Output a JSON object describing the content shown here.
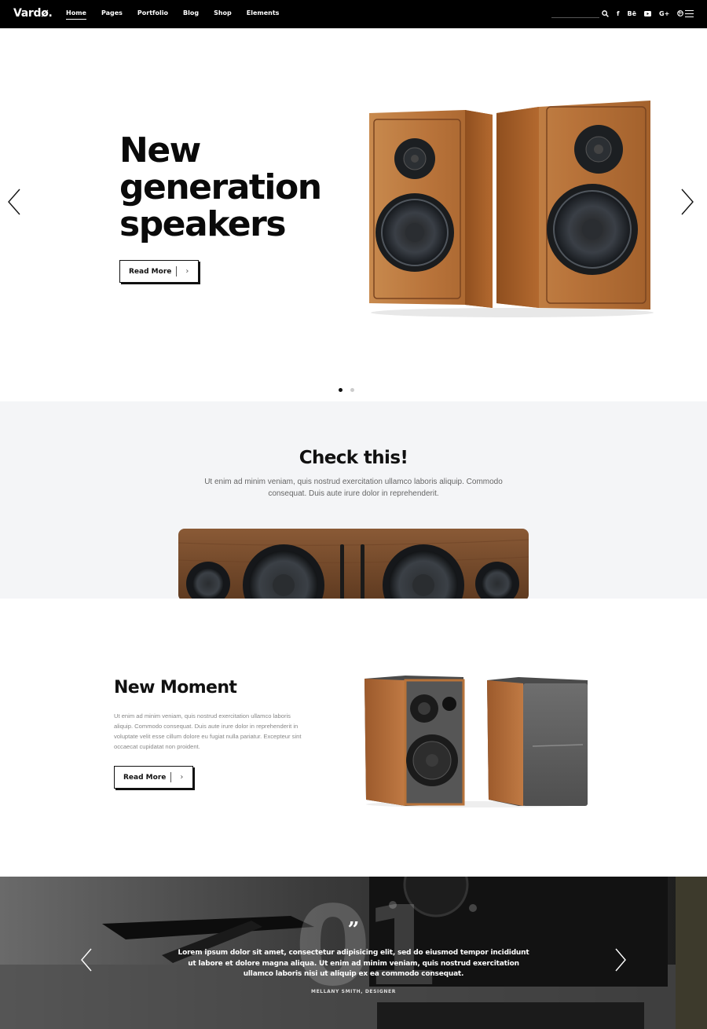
{
  "nav": {
    "logo": "Vardø.",
    "menu": [
      "Home",
      "Pages",
      "Portfolio",
      "Blog",
      "Shop",
      "Elements"
    ],
    "active_item": "Home",
    "social": {
      "search_icon": "search-icon",
      "facebook": "f",
      "behance": "Bē",
      "youtube_icon": "youtube-icon",
      "googleplus": "G+",
      "dribbble_icon": "dribbble-icon",
      "menu_icon": "hamburger-icon"
    }
  },
  "hero": {
    "title_lines": [
      "New",
      "generation",
      "speakers"
    ],
    "button_label": "Read More",
    "slides": 2,
    "active_slide": 1
  },
  "check": {
    "title": "Check this!",
    "text": "Ut enim ad minim veniam, quis nostrud exercitation ullamco laboris aliquip. Commodo consequat. Duis aute irure dolor in reprehenderit."
  },
  "moment": {
    "title": "New Moment",
    "text": "Ut enim ad minim veniam, quis nostrud exercitation ullamco laboris aliquip. Commodo consequat. Duis aute irure dolor in reprehenderit in voluptate velit esse cillum dolore eu fugiat nulla pariatur. Excepteur sint occaecat cupidatat non proident.",
    "button_label": "Read More"
  },
  "testimonial": {
    "number": "01",
    "quote": "Lorem ipsum dolor sit amet, consectetur adipisicing elit, sed do eiusmod tempor incididunt ut labore et dolore magna aliqua. Ut enim ad minim veniam, quis nostrud exercitation ullamco laboris nisi ut aliquip ex ea commodo consequat.",
    "author": "MELLANY SMITH, DESIGNER"
  },
  "colors": {
    "nav_bg": "#000000",
    "section_bg": "#f4f5f7",
    "wood": "#b8733a"
  }
}
